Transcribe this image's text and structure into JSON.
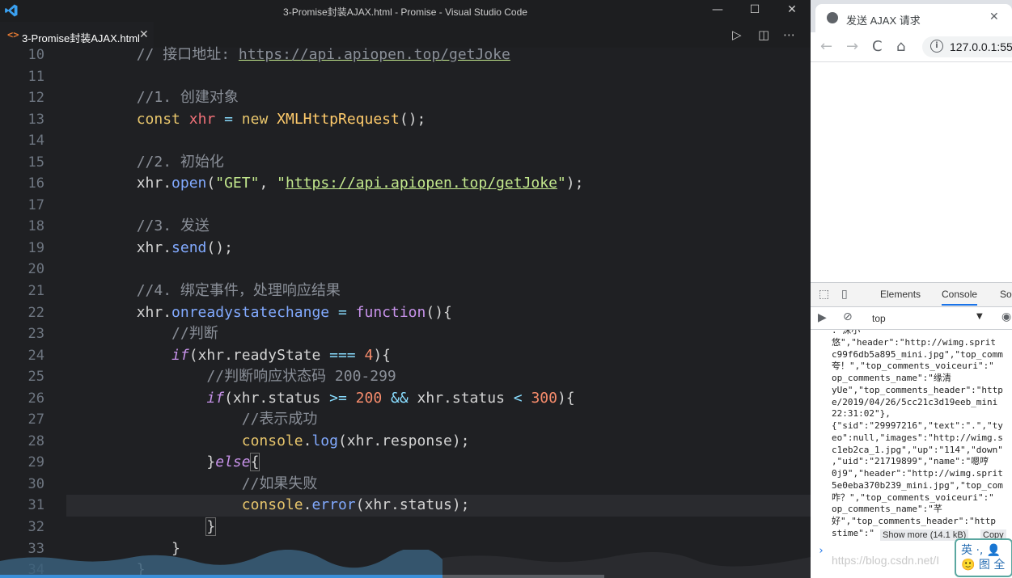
{
  "vscode": {
    "window_title": "3-Promise封装AJAX.html - Promise - Visual Studio Code",
    "controls": {
      "minimize": "—",
      "maximize": "☐",
      "close": "✕"
    },
    "tab": {
      "icon": "<>",
      "label": "3-Promise封装AJAX.html",
      "close": "✕"
    },
    "toolbar": {
      "run": "▷",
      "split": "◫",
      "more": "⋯"
    },
    "line_numbers": [
      "10",
      "11",
      "12",
      "13",
      "14",
      "15",
      "16",
      "17",
      "18",
      "19",
      "20",
      "21",
      "22",
      "23",
      "24",
      "25",
      "26",
      "27",
      "28",
      "29",
      "30",
      "31",
      "32",
      "33",
      "34"
    ],
    "current_line": "31"
  },
  "browser": {
    "tab_title": "发送 AJAX 请求",
    "tab_close": "✕",
    "nav": {
      "back": "←",
      "forward": "→",
      "reload": "C",
      "home": "⌂"
    },
    "address": "127.0.0.1:55",
    "devtools": {
      "tabs": [
        "Elements",
        "Console",
        "So"
      ],
      "active_tab": "Console",
      "context": "top",
      "console_lines": [
        ":\"沫小",
        "悠\",\"header\":\"http://wimg.sprit",
        "c99f6db5a895_mini.jpg\",\"top_comm",
        "夸！\",\"top_comments_voiceuri\":\"",
        "op_comments_name\":\"缘清",
        "yUe\",\"top_comments_header\":\"http",
        "e/2019/04/26/5cc21c3d19eeb_mini",
        "22:31:02\"},",
        "{\"sid\":\"29997216\",\"text\":\".\",\"ty",
        "eo\":null,\"images\":\"http://wimg.s",
        "c1eb2ca_1.jpg\",\"up\":\"114\",\"down\"",
        ",\"uid\":\"21719899\",\"name\":\"嗯哼",
        "0j9\",\"header\":\"http://wimg.sprit",
        "5e0eba370b239_mini.jpg\",\"top_com",
        "咋？\",\"top_comments_voiceuri\":\"",
        "op_comments_name\":\"芊",
        "好\",\"top_comments_header\":\"http",
        "stime\":\""
      ],
      "show_more": "Show more (14.1 kB)",
      "copy": "Copy",
      "prompt": "›"
    }
  },
  "watermark": "https://blog.csdn.net/I",
  "ime": "英 ·, 👤\n🙂 图 全"
}
